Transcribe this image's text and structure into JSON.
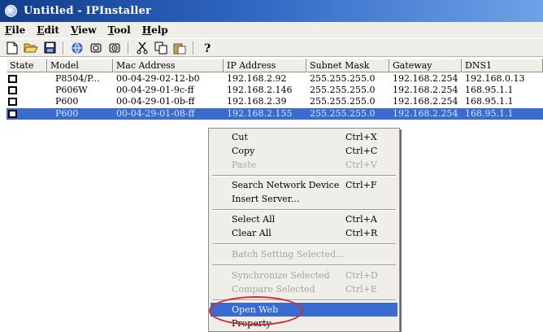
{
  "window": {
    "title": "Untitled - IPInstaller",
    "icon": "globe-icon"
  },
  "menu": [
    {
      "label": "File",
      "ul": "F",
      "rest": "ile"
    },
    {
      "label": "Edit",
      "ul": "E",
      "rest": "dit"
    },
    {
      "label": "View",
      "ul": "V",
      "rest": "iew"
    },
    {
      "label": "Tool",
      "ul": "T",
      "rest": "ool"
    },
    {
      "label": "Help",
      "ul": "H",
      "rest": "elp"
    }
  ],
  "toolbar": {
    "icons": [
      "new-file-icon",
      "open-folder-icon",
      "save-icon",
      "search-network-icon",
      "device-icon",
      "device-settings-icon",
      "cut-icon",
      "copy-icon",
      "paste-icon",
      "help-icon"
    ]
  },
  "table": {
    "columns": [
      "State",
      "Model",
      "Mac Address",
      "IP Address",
      "Subnet Mask",
      "Gateway",
      "DNS1"
    ],
    "rows": [
      {
        "model": "P8504/P...",
        "mac": "00-04-29-02-12-b0",
        "ip": "192.168.2.92",
        "mask": "255.255.255.0",
        "gateway": "192.168.2.254",
        "dns1": "192.168.0.13",
        "selected": false
      },
      {
        "model": "P606W",
        "mac": "00-04-29-01-9c-ff",
        "ip": "192.168.2.146",
        "mask": "255.255.255.0",
        "gateway": "192.168.2.254",
        "dns1": "168.95.1.1",
        "selected": false
      },
      {
        "model": "P600",
        "mac": "00-04-29-01-0b-ff",
        "ip": "192.168.2.39",
        "mask": "255.255.255.0",
        "gateway": "192.168.2.254",
        "dns1": "168.95.1.1",
        "selected": false
      },
      {
        "model": "P600",
        "mac": "00-04-29-01-08-ff",
        "ip": "192.168.2.155",
        "mask": "255.255.255.0",
        "gateway": "192.168.2.254",
        "dns1": "168.95.1.1",
        "selected": true
      }
    ]
  },
  "context_menu": {
    "items": [
      {
        "label": "Cut",
        "ul": "t",
        "shortcut": "Ctrl+X",
        "disabled": false
      },
      {
        "label": "Copy",
        "ul": "C",
        "shortcut": "Ctrl+C",
        "disabled": false
      },
      {
        "label": "Paste",
        "ul": "P",
        "shortcut": "Ctrl+V",
        "disabled": true
      },
      {
        "label": "Search Network Device",
        "ul": "S",
        "shortcut": "Ctrl+F",
        "disabled": false
      },
      {
        "label": "Insert Server...",
        "ul": "I",
        "shortcut": "",
        "disabled": false
      },
      {
        "label": "Select All",
        "ul": "l",
        "shortcut": "Ctrl+A",
        "disabled": false
      },
      {
        "label": "Clear All",
        "ul": "r",
        "shortcut": "Ctrl+R",
        "disabled": false
      },
      {
        "label": "Batch Setting Selected...",
        "ul": "",
        "shortcut": "",
        "disabled": true
      },
      {
        "label": "Synchronize Selected",
        "ul": "",
        "shortcut": "Ctrl+D",
        "disabled": true
      },
      {
        "label": "Compare Selected",
        "ul": "",
        "shortcut": "Ctrl+E",
        "disabled": true
      },
      {
        "label": "Open Web",
        "ul": "O",
        "shortcut": "",
        "disabled": false,
        "active": true
      },
      {
        "label": "Property",
        "ul": "P",
        "shortcut": "",
        "disabled": false
      }
    ]
  },
  "colors": {
    "selection": "#3a6ccf",
    "highlight_ring": "#d42a36",
    "titlebar_start": "#123d8a",
    "titlebar_end": "#6ea2e8"
  }
}
